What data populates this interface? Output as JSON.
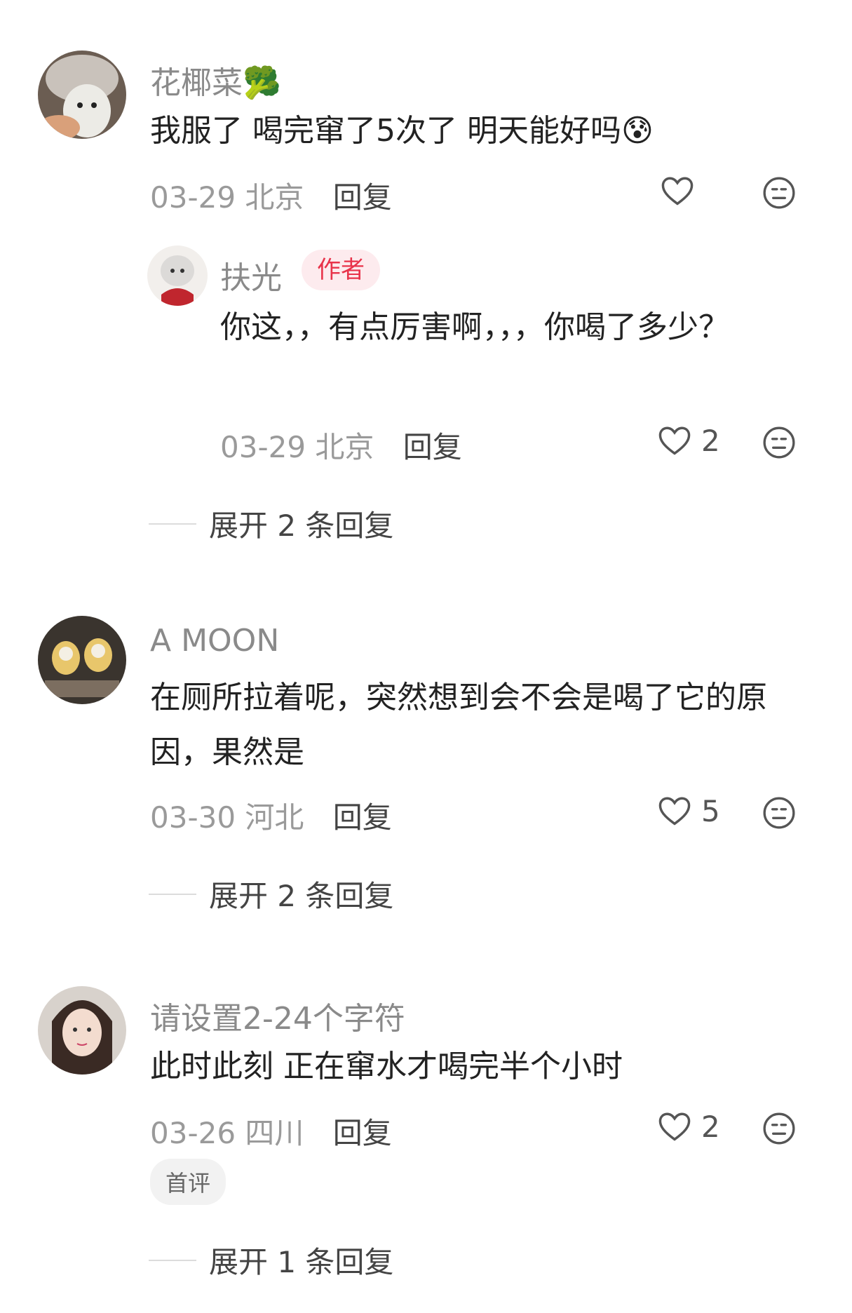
{
  "comments": [
    {
      "username": "花椰菜",
      "username_emoji": "🥦",
      "text": "我服了 喝完窜了5次了 明天能好吗",
      "text_emoji": "😰",
      "date": "03-29",
      "location": "北京",
      "reply_label": "回复",
      "likes": "",
      "reply": {
        "username": "扶光",
        "author_tag": "作者",
        "text": "你这，，有点厉害啊，，，你喝了多少？",
        "date": "03-29",
        "location": "北京",
        "reply_label": "回复",
        "likes": "2"
      },
      "expand_label": "展开 2 条回复"
    },
    {
      "username": "A MOON",
      "text": "在厕所拉着呢，突然想到会不会是喝了它的原因，果然是",
      "date": "03-30",
      "location": "河北",
      "reply_label": "回复",
      "likes": "5",
      "expand_label": "展开 2 条回复"
    },
    {
      "username": "请设置2-24个字符",
      "text": "此时此刻 正在窜水才喝完半个小时",
      "date": "03-26",
      "location": "四川",
      "reply_label": "回复",
      "likes": "2",
      "badge": "首评",
      "expand_label": "展开 1 条回复"
    }
  ],
  "icons": {
    "like": "heart-outline-icon",
    "dislike": "neutral-face-icon"
  },
  "colors": {
    "author_tag_bg": "#fdebee",
    "author_tag_text": "#e8334a",
    "meta_gray": "#9a9a9a"
  }
}
